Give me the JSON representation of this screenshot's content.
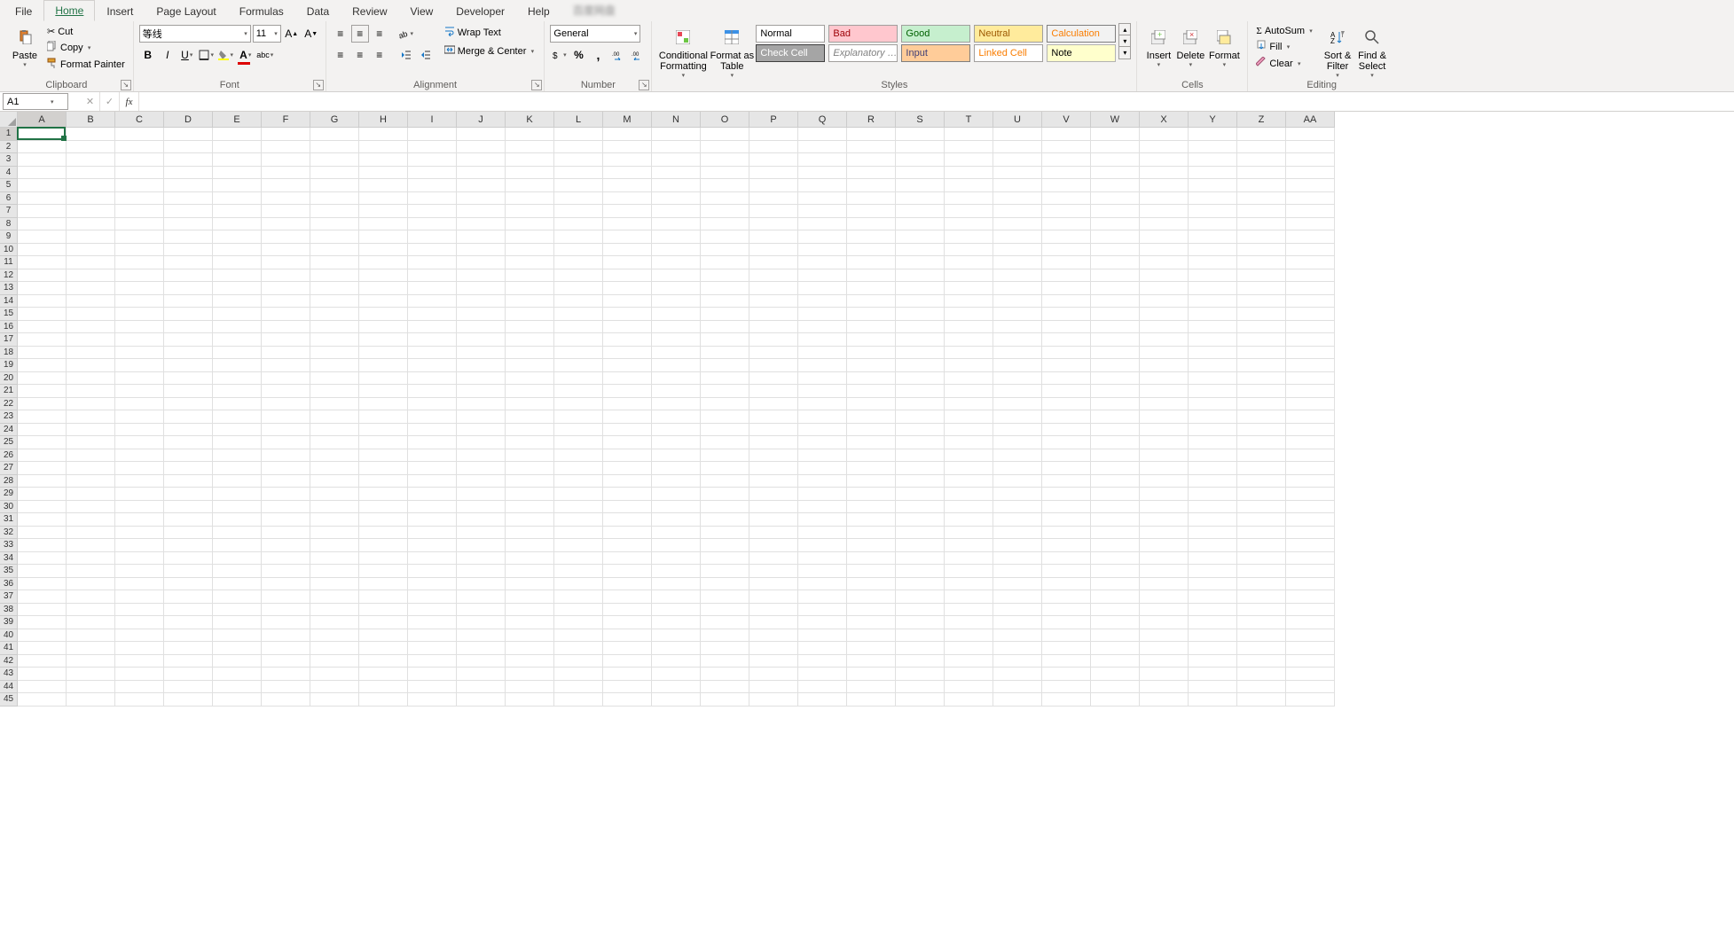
{
  "tabs": [
    "File",
    "Home",
    "Insert",
    "Page Layout",
    "Formulas",
    "Data",
    "Review",
    "View",
    "Developer",
    "Help"
  ],
  "active_tab": 1,
  "clipboard": {
    "paste": "Paste",
    "cut": "Cut",
    "copy": "Copy",
    "format_painter": "Format Painter",
    "label": "Clipboard"
  },
  "font": {
    "name": "等线",
    "size": "11",
    "label": "Font"
  },
  "alignment": {
    "wrap": "Wrap Text",
    "merge": "Merge & Center",
    "label": "Alignment"
  },
  "number": {
    "format": "General",
    "label": "Number"
  },
  "styles": {
    "cond": "Conditional\nFormatting",
    "table": "Format as\nTable",
    "row1": [
      {
        "t": "Normal",
        "bg": "#ffffff",
        "fg": "#000000",
        "bd": "#a19f9d"
      },
      {
        "t": "Bad",
        "bg": "#ffc7ce",
        "fg": "#9c0006",
        "bd": "#a19f9d"
      },
      {
        "t": "Good",
        "bg": "#c6efce",
        "fg": "#006100",
        "bd": "#a19f9d"
      },
      {
        "t": "Neutral",
        "bg": "#ffeb9c",
        "fg": "#9c5700",
        "bd": "#a19f9d"
      },
      {
        "t": "Calculation",
        "bg": "#f2f2f2",
        "fg": "#fa7d00",
        "bd": "#7f7f7f"
      }
    ],
    "row2": [
      {
        "t": "Check Cell",
        "bg": "#a5a5a5",
        "fg": "#ffffff",
        "bd": "#3f3f3f"
      },
      {
        "t": "Explanatory …",
        "bg": "#ffffff",
        "fg": "#7f7f7f",
        "bd": "#a19f9d",
        "italic": true
      },
      {
        "t": "Input",
        "bg": "#ffcc99",
        "fg": "#3f3f76",
        "bd": "#7f7f7f"
      },
      {
        "t": "Linked Cell",
        "bg": "#ffffff",
        "fg": "#fa7d00",
        "bd": "#a19f9d"
      },
      {
        "t": "Note",
        "bg": "#ffffcc",
        "fg": "#000000",
        "bd": "#b2b2b2"
      }
    ],
    "label": "Styles"
  },
  "cells": {
    "insert": "Insert",
    "delete": "Delete",
    "format": "Format",
    "label": "Cells"
  },
  "editing": {
    "autosum": "AutoSum",
    "fill": "Fill",
    "clear": "Clear",
    "sort": "Sort &\nFilter",
    "find": "Find &\nSelect",
    "label": "Editing"
  },
  "namebox": "A1",
  "formula": "",
  "columns": [
    "A",
    "B",
    "C",
    "D",
    "E",
    "F",
    "G",
    "H",
    "I",
    "J",
    "K",
    "L",
    "M",
    "N",
    "O",
    "P",
    "Q",
    "R",
    "S",
    "T",
    "U",
    "V",
    "W",
    "X",
    "Y",
    "Z",
    "AA"
  ],
  "row_count": 45,
  "sel": {
    "col": 0,
    "row": 0
  }
}
